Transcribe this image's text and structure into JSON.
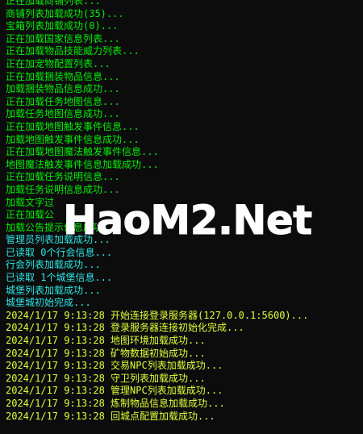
{
  "console": {
    "lines": [
      {
        "text": "正在加载商铺列表...",
        "style": "plain"
      },
      {
        "text": "商铺列表加载成功(35)...",
        "style": "plain"
      },
      {
        "text": "宝箱列表加载成功(0)...",
        "style": "plain"
      },
      {
        "text": "正在加载国家信息列表...",
        "style": "plain"
      },
      {
        "text": "正在加载物品技能威力列表...",
        "style": "plain"
      },
      {
        "text": "正在加宠物配置列表...",
        "style": "plain"
      },
      {
        "text": "正在加载捆装物品信息...",
        "style": "plain"
      },
      {
        "text": "加载捆装物品信息成功...",
        "style": "plain"
      },
      {
        "text": "正在加载任务地图信息...",
        "style": "plain"
      },
      {
        "text": "加载任务地图信息成功...",
        "style": "plain"
      },
      {
        "text": "正在加载地图触发事件信息...",
        "style": "plain"
      },
      {
        "text": "加载地图触发事件信息成功...",
        "style": "plain"
      },
      {
        "text": "正在加载地图魔法触发事件信息...",
        "style": "plain"
      },
      {
        "text": "地图魔法触发事件信息加载成功...",
        "style": "plain"
      },
      {
        "text": "正在加载任务说明信息...",
        "style": "plain"
      },
      {
        "text": "加载任务说明信息成功...",
        "style": "plain"
      },
      {
        "text": "加载文字过",
        "style": "plain"
      },
      {
        "text": "正在加载公",
        "style": "plain"
      },
      {
        "text": "加载公告提示信息成功...",
        "style": "plain"
      },
      {
        "text": "管理员列表加载成功...",
        "style": "cyan"
      },
      {
        "text": "已读取 0个行会信息...",
        "style": "cyan"
      },
      {
        "text": "行会列表加载成功...",
        "style": "cyan"
      },
      {
        "text": "已读取 1个城堡信息...",
        "style": "cyan"
      },
      {
        "text": "城堡列表加载成功...",
        "style": "cyan"
      },
      {
        "text": "城堡城初始完成...",
        "style": "cyan"
      },
      {
        "text": "2024/1/17 9:13:28 开始连接登录服务器(127.0.0.1:5600)...",
        "style": "log"
      },
      {
        "text": "2024/1/17 9:13:28 登录服务器连接初始化完成...",
        "style": "log"
      },
      {
        "text": "2024/1/17 9:13:28 地图环境加载成功...",
        "style": "log"
      },
      {
        "text": "2024/1/17 9:13:28 矿物数据初始成功...",
        "style": "log"
      },
      {
        "text": "2024/1/17 9:13:28 交易NPC列表加载成功...",
        "style": "log"
      },
      {
        "text": "2024/1/17 9:13:28 守卫列表加载成功...",
        "style": "log"
      },
      {
        "text": "2024/1/17 9:13:28 管理NPC列表加载成功...",
        "style": "log"
      },
      {
        "text": "2024/1/17 9:13:28 炼制物品信息加载成功...",
        "style": "log"
      },
      {
        "text": "2024/1/17 9:13:28 回城点配置加载成功...",
        "style": "log"
      }
    ]
  },
  "watermark": {
    "text": "HaoM2.Net"
  },
  "colors": {
    "background": "#0c0c0c",
    "plain": "#00f000",
    "cyan": "#2ee6e6",
    "log": "#e3ff3a"
  }
}
